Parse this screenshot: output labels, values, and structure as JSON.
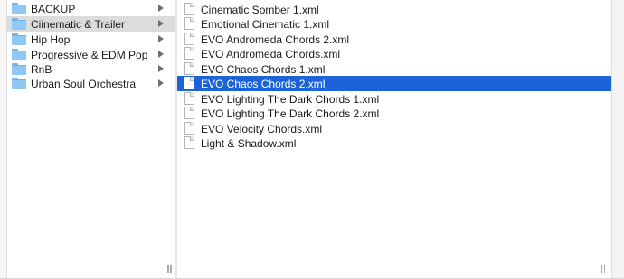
{
  "folders": [
    {
      "label": "BACKUP",
      "selected": false
    },
    {
      "label": "Ciinematic & Trailer",
      "selected": true
    },
    {
      "label": "Hip Hop",
      "selected": false
    },
    {
      "label": "Progressive & EDM Pop",
      "selected": false
    },
    {
      "label": "RnB",
      "selected": false
    },
    {
      "label": "Urban Soul Orchestra",
      "selected": false
    }
  ],
  "files": [
    {
      "label": "Cinematic Somber 1.xml",
      "selected": false
    },
    {
      "label": "Emotional Cinematic 1.xml",
      "selected": false
    },
    {
      "label": "EVO Andromeda Chords 2.xml",
      "selected": false
    },
    {
      "label": "EVO Andromeda Chords.xml",
      "selected": false
    },
    {
      "label": "EVO Chaos Chords 1.xml",
      "selected": false
    },
    {
      "label": "EVO Chaos Chords 2.xml",
      "selected": true
    },
    {
      "label": "EVO Lighting The Dark Chords 1.xml",
      "selected": false
    },
    {
      "label": "EVO Lighting The Dark Chords 2.xml",
      "selected": false
    },
    {
      "label": "EVO Velocity Chords.xml",
      "selected": false
    },
    {
      "label": "Light & Shadow.xml",
      "selected": false
    }
  ],
  "icons": {
    "folder": "folder-icon",
    "file": "document-icon",
    "disclosure": "chevron-right-icon"
  },
  "colors": {
    "selection_active": "#1b63d6",
    "selection_inactive": "#dcdcdc",
    "folder_blue": "#8fc8f5"
  }
}
